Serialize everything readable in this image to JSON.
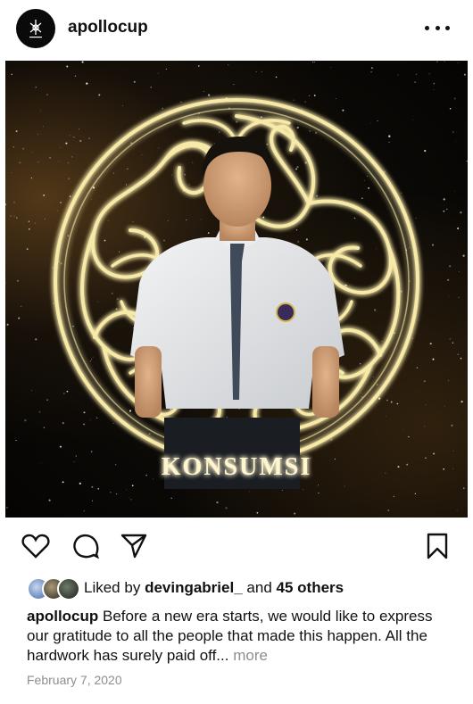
{
  "header": {
    "username": "apollocup",
    "avatar_icon": "apollo-logo-icon",
    "more_icon": "more-options-icon"
  },
  "post": {
    "image_label": "KONSUMSI",
    "image_description_icon": "post-photo"
  },
  "actions": {
    "like_icon": "heart-icon",
    "comment_icon": "comment-icon",
    "share_icon": "share-icon",
    "save_icon": "bookmark-icon"
  },
  "likes": {
    "prefix": "Liked by",
    "user": "devingabriel_",
    "conjunction": "and",
    "others": "45 others"
  },
  "caption": {
    "username": "apollocup",
    "text": "Before a new era starts, we would like to express our gratitude to all the people that made this happen. All the hardwork has surely paid off...",
    "more_label": "more"
  },
  "date": "February 7, 2020",
  "colors": {
    "text": "#111111",
    "muted": "#8e8e8e",
    "glow": "#f6e7a6"
  }
}
